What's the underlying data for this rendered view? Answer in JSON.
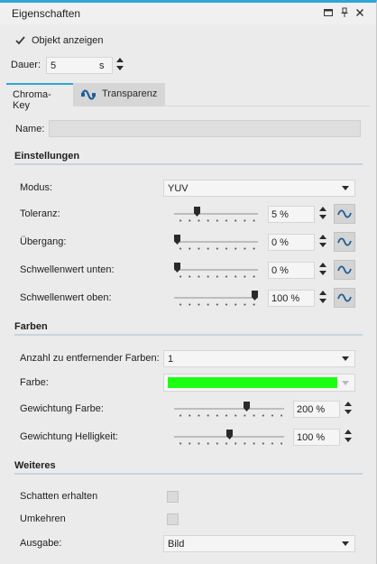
{
  "window": {
    "title": "Eigenschaften",
    "icons": [
      "maximize-icon",
      "pin-icon",
      "close-icon"
    ]
  },
  "show_object": {
    "label": "Objekt anzeigen",
    "checked": true
  },
  "duration": {
    "label": "Dauer:",
    "value": "5",
    "unit": "s"
  },
  "tabs": [
    {
      "label": "Chroma-Key",
      "active": true
    },
    {
      "label": "Transparenz",
      "active": false,
      "icon": "transparency-icon"
    }
  ],
  "name": {
    "label": "Name:",
    "value": ""
  },
  "settings": {
    "heading": "Einstellungen",
    "mode": {
      "label": "Modus:",
      "value": "YUV"
    },
    "rows": [
      {
        "label": "Toleranz:",
        "value": "5 %",
        "slider_fraction": 0.25
      },
      {
        "label": "Übergang:",
        "value": "0 %",
        "slider_fraction": 0.0
      },
      {
        "label": "Schwellenwert unten:",
        "value": "0 %",
        "slider_fraction": 0.0
      },
      {
        "label": "Schwellenwert oben:",
        "value": "100 %",
        "slider_fraction": 1.0
      }
    ]
  },
  "colors": {
    "heading": "Farben",
    "count": {
      "label": "Anzahl zu entfernender Farben:",
      "value": "1"
    },
    "color": {
      "label": "Farbe:",
      "swatch": "#1dff12"
    },
    "weight_color": {
      "label": "Gewichtung Farbe:",
      "value": "200 %",
      "slider_fraction": 0.67
    },
    "weight_brightness": {
      "label": "Gewichtung Helligkeit:",
      "value": "100 %",
      "slider_fraction": 0.5
    }
  },
  "more": {
    "heading": "Weiteres",
    "keep_shadow": {
      "label": "Schatten erhalten",
      "checked": false
    },
    "invert": {
      "label": "Umkehren",
      "checked": false
    },
    "output": {
      "label": "Ausgabe:",
      "value": "Bild"
    }
  },
  "accent_color": "#2ea6d9"
}
